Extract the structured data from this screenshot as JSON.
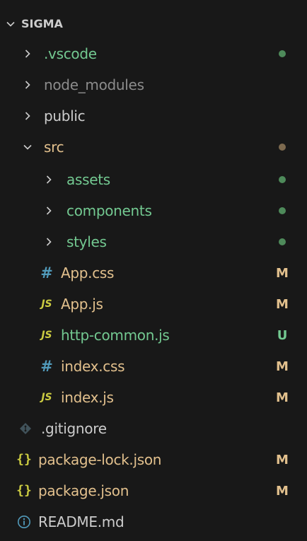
{
  "colors": {
    "background": "#181818",
    "text_default": "#cccccc",
    "text_ignored": "#8c8c8c",
    "text_untracked": "#73c991",
    "text_modified": "#e2c08d",
    "dot_green": "#4e8a5a",
    "dot_brown": "#7d6a4f",
    "badge_modified": "#e2c08d",
    "badge_untracked": "#73c991",
    "css_icon": "#519aba",
    "js_icon": "#cbcb41",
    "json_icon": "#cbcb41",
    "git_icon": "#41535b",
    "info_icon": "#519aba"
  },
  "explorer": {
    "root": {
      "label": "SIGMA",
      "icon": "chevron-down-icon"
    },
    "items": [
      {
        "label": ".vscode",
        "type": "folder",
        "expanded": false,
        "decoration": "dot"
      },
      {
        "label": "node_modules",
        "type": "folder",
        "expanded": false
      },
      {
        "label": "public",
        "type": "folder",
        "expanded": false
      },
      {
        "label": "src",
        "type": "folder",
        "expanded": true,
        "decoration": "dot"
      },
      {
        "label": "assets",
        "type": "folder",
        "expanded": false,
        "decoration": "dot"
      },
      {
        "label": "components",
        "type": "folder",
        "expanded": false,
        "decoration": "dot"
      },
      {
        "label": "styles",
        "type": "folder",
        "expanded": false,
        "decoration": "dot"
      },
      {
        "label": "App.css",
        "type": "file",
        "icon": "css-hash-icon",
        "icon_text": "#",
        "badge": "M"
      },
      {
        "label": "App.js",
        "type": "file",
        "icon": "js-icon",
        "icon_text": "JS",
        "badge": "M"
      },
      {
        "label": "http-common.js",
        "type": "file",
        "icon": "js-icon",
        "icon_text": "JS",
        "badge": "U"
      },
      {
        "label": "index.css",
        "type": "file",
        "icon": "css-hash-icon",
        "icon_text": "#",
        "badge": "M"
      },
      {
        "label": "index.js",
        "type": "file",
        "icon": "js-icon",
        "icon_text": "JS",
        "badge": "M"
      },
      {
        "label": ".gitignore",
        "type": "file",
        "icon": "git-diamond-icon"
      },
      {
        "label": "package-lock.json",
        "type": "file",
        "icon": "json-braces-icon",
        "icon_text": "{}",
        "badge": "M"
      },
      {
        "label": "package.json",
        "type": "file",
        "icon": "json-braces-icon",
        "icon_text": "{}",
        "badge": "M"
      },
      {
        "label": "README.md",
        "type": "file",
        "icon": "info-circle-icon"
      }
    ]
  }
}
